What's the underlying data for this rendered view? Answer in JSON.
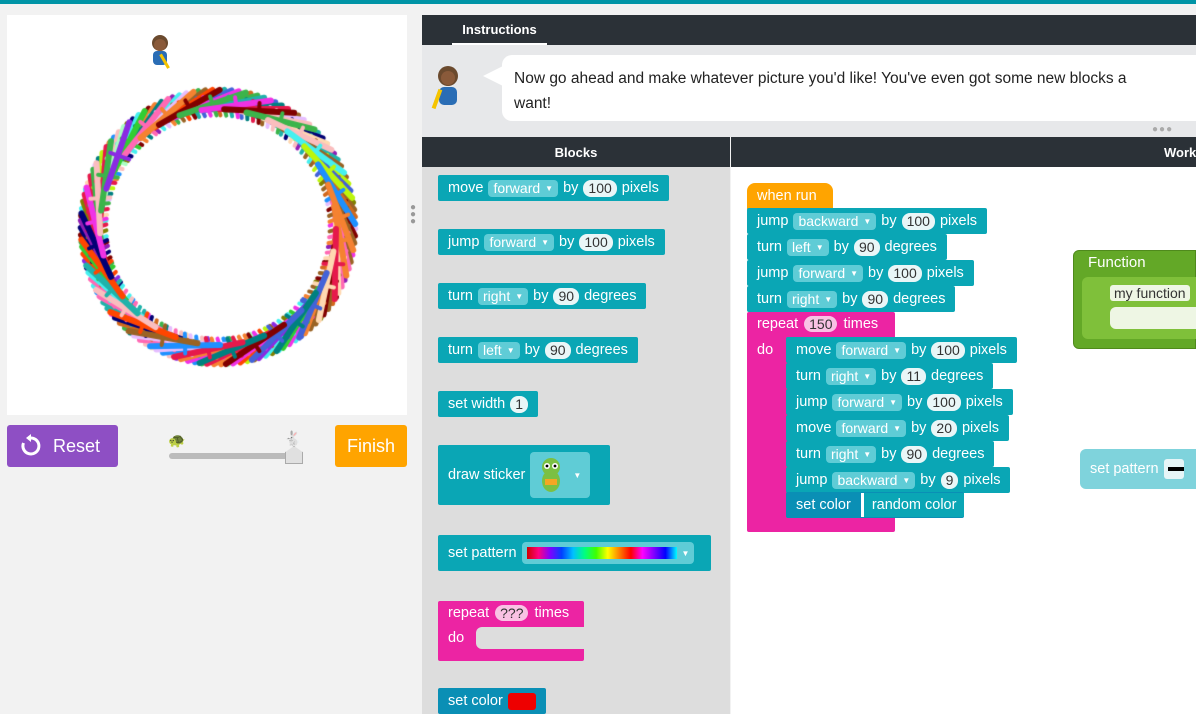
{
  "controls": {
    "reset_label": "Reset",
    "finish_label": "Finish"
  },
  "instructions": {
    "tab_label": "Instructions",
    "text_line1": "Now go ahead and make whatever picture you'd like! You've even got some new blocks a",
    "text_line2": "want!"
  },
  "headers": {
    "blocks": "Blocks",
    "workspace": "Work"
  },
  "toolbox": {
    "move": {
      "verb": "move",
      "dir": "forward",
      "by": "by",
      "amount": "100",
      "unit": "pixels"
    },
    "jump": {
      "verb": "jump",
      "dir": "forward",
      "by": "by",
      "amount": "100",
      "unit": "pixels"
    },
    "turn_right": {
      "verb": "turn",
      "dir": "right",
      "by": "by",
      "amount": "90",
      "unit": "degrees"
    },
    "turn_left": {
      "verb": "turn",
      "dir": "left",
      "by": "by",
      "amount": "90",
      "unit": "degrees"
    },
    "set_width": {
      "label": "set width",
      "amount": "1"
    },
    "draw_sticker": {
      "label": "draw sticker"
    },
    "set_pattern": {
      "label": "set pattern"
    },
    "repeat": {
      "label": "repeat",
      "amount": "???",
      "unit": "times",
      "do": "do"
    },
    "set_color": {
      "label": "set color"
    }
  },
  "workspace": {
    "hat": "when run",
    "b1": {
      "verb": "jump",
      "dir": "backward",
      "by": "by",
      "amount": "100",
      "unit": "pixels"
    },
    "b2": {
      "verb": "turn",
      "dir": "left",
      "by": "by",
      "amount": "90",
      "unit": "degrees"
    },
    "b3": {
      "verb": "jump",
      "dir": "forward",
      "by": "by",
      "amount": "100",
      "unit": "pixels"
    },
    "b4": {
      "verb": "turn",
      "dir": "right",
      "by": "by",
      "amount": "90",
      "unit": "degrees"
    },
    "repeat": {
      "label": "repeat",
      "amount": "150",
      "unit": "times",
      "do": "do"
    },
    "r1": {
      "verb": "move",
      "dir": "forward",
      "by": "by",
      "amount": "100",
      "unit": "pixels"
    },
    "r2": {
      "verb": "turn",
      "dir": "right",
      "by": "by",
      "amount": "11",
      "unit": "degrees"
    },
    "r3": {
      "verb": "jump",
      "dir": "forward",
      "by": "by",
      "amount": "100",
      "unit": "pixels"
    },
    "r4": {
      "verb": "move",
      "dir": "forward",
      "by": "by",
      "amount": "20",
      "unit": "pixels"
    },
    "r5": {
      "verb": "turn",
      "dir": "right",
      "by": "by",
      "amount": "90",
      "unit": "degrees"
    },
    "r6": {
      "verb": "jump",
      "dir": "backward",
      "by": "by",
      "amount": "9",
      "unit": "pixels"
    },
    "set_color": {
      "label": "set color",
      "value": "random color"
    },
    "function": {
      "title": "Function",
      "name": "my function"
    },
    "set_pattern": {
      "label": "set pattern"
    }
  },
  "colors": {
    "motion": "#0aa6b5",
    "hat": "#ffa400",
    "loop": "#ec24a3",
    "function": "#63a827",
    "reset": "#8e4fc4"
  }
}
